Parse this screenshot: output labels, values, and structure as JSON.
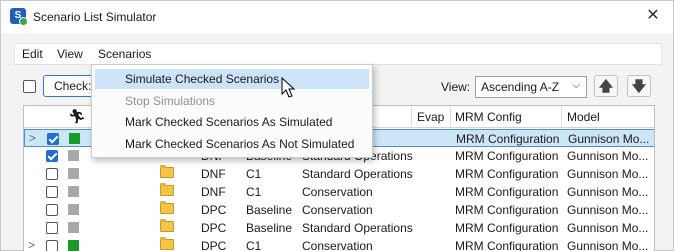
{
  "window": {
    "title": "Scenario List Simulator",
    "close_glyph": "✕",
    "icon": "app-logo-icon"
  },
  "menubar": {
    "items": [
      "Edit",
      "View",
      "Scenarios"
    ]
  },
  "toolbar": {
    "check_button_label": "Check:",
    "view_label": "View:",
    "view_value": "Ascending A-Z",
    "move_up_glyph": "🡅",
    "move_down_glyph": "🡇"
  },
  "dropdown": {
    "items": [
      {
        "label": "Simulate Checked Scenarios",
        "state": "hover"
      },
      {
        "label": "Stop Simulations",
        "state": "disabled"
      },
      {
        "label": "Mark Checked Scenarios As Simulated",
        "state": "normal"
      },
      {
        "label": "Mark Checked Scenarios As Not Simulated",
        "state": "normal"
      }
    ]
  },
  "table": {
    "headers": {
      "run_icon": "running-person-icon",
      "evap": "Evap",
      "mrm": "MRM Config",
      "model": "Model"
    },
    "rows": [
      {
        "expander": ">",
        "checked": true,
        "status_color": "#1a9a2a",
        "c1": "",
        "c2": "",
        "c3": "",
        "mrm": "MRM Configuration",
        "model": "Gunnison Mo...",
        "selected": true,
        "folder": false
      },
      {
        "expander": "",
        "checked": true,
        "status_color": "#a8a8a8",
        "c1": "DNF",
        "c2": "Baseline",
        "c3": "Standard Operations",
        "mrm": "MRM Configuration",
        "model": "Gunnison Mo...",
        "selected": false,
        "folder": false
      },
      {
        "expander": "",
        "checked": false,
        "status_color": "#a8a8a8",
        "c1": "DNF",
        "c2": "C1",
        "c3": "Standard Operations",
        "mrm": "MRM Configuration",
        "model": "Gunnison Mo...",
        "selected": false,
        "folder": true
      },
      {
        "expander": "",
        "checked": false,
        "status_color": "#a8a8a8",
        "c1": "DNF",
        "c2": "C1",
        "c3": "Conservation",
        "mrm": "MRM Configuration",
        "model": "Gunnison Mo...",
        "selected": false,
        "folder": true
      },
      {
        "expander": "",
        "checked": false,
        "status_color": "#a8a8a8",
        "c1": "DPC",
        "c2": "Baseline",
        "c3": "Conservation",
        "mrm": "MRM Configuration",
        "model": "Gunnison Mo...",
        "selected": false,
        "folder": true
      },
      {
        "expander": "",
        "checked": false,
        "status_color": "#a8a8a8",
        "c1": "DPC",
        "c2": "Baseline",
        "c3": "Standard Operations",
        "mrm": "MRM Configuration",
        "model": "Gunnison Mo...",
        "selected": false,
        "folder": true
      },
      {
        "expander": ">",
        "checked": false,
        "status_color": "#1a9a2a",
        "c1": "DPC",
        "c2": "C1",
        "c3": "Conservation",
        "mrm": "MRM Configuration",
        "model": "Gunnison Mo...",
        "selected": false,
        "folder": true
      }
    ]
  },
  "colors": {
    "accent": "#2f7ad7",
    "selection": "#cde6f7",
    "hover": "#cce4f7",
    "folder": "#f4c542"
  }
}
